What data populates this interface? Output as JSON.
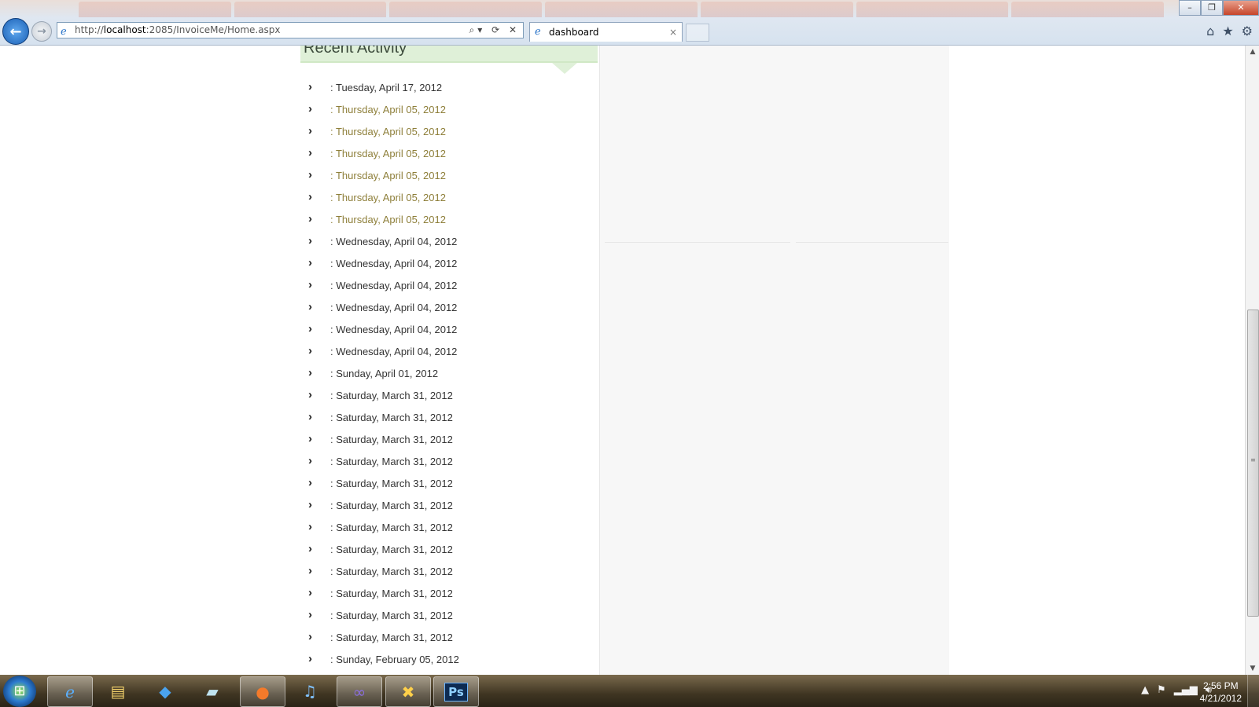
{
  "browser": {
    "address_prefix": "http://",
    "address_host": "localhost",
    "address_rest": ":2085/InvoiceMe/Home.aspx",
    "active_tab": "dashboard",
    "tab_close": "×",
    "addr_tools": "⌕▾ ⟳ ✕",
    "window_minimize": "–",
    "window_restore": "❐",
    "window_close": "✕"
  },
  "panel": {
    "title": "Recent Activity"
  },
  "activity": [
    {
      "text": ": Tuesday, April 17, 2012",
      "highlight": false
    },
    {
      "text": ": Thursday, April 05, 2012",
      "highlight": true
    },
    {
      "text": ": Thursday, April 05, 2012",
      "highlight": true
    },
    {
      "text": ": Thursday, April 05, 2012",
      "highlight": true
    },
    {
      "text": ": Thursday, April 05, 2012",
      "highlight": true
    },
    {
      "text": ": Thursday, April 05, 2012",
      "highlight": true
    },
    {
      "text": ": Thursday, April 05, 2012",
      "highlight": true
    },
    {
      "text": ": Wednesday, April 04, 2012",
      "highlight": false
    },
    {
      "text": ": Wednesday, April 04, 2012",
      "highlight": false
    },
    {
      "text": ": Wednesday, April 04, 2012",
      "highlight": false
    },
    {
      "text": ": Wednesday, April 04, 2012",
      "highlight": false
    },
    {
      "text": ": Wednesday, April 04, 2012",
      "highlight": false
    },
    {
      "text": ": Wednesday, April 04, 2012",
      "highlight": false
    },
    {
      "text": ": Sunday, April 01, 2012",
      "highlight": false
    },
    {
      "text": ": Saturday, March 31, 2012",
      "highlight": false
    },
    {
      "text": ": Saturday, March 31, 2012",
      "highlight": false
    },
    {
      "text": ": Saturday, March 31, 2012",
      "highlight": false
    },
    {
      "text": ": Saturday, March 31, 2012",
      "highlight": false
    },
    {
      "text": ": Saturday, March 31, 2012",
      "highlight": false
    },
    {
      "text": ": Saturday, March 31, 2012",
      "highlight": false
    },
    {
      "text": ": Saturday, March 31, 2012",
      "highlight": false
    },
    {
      "text": ": Saturday, March 31, 2012",
      "highlight": false
    },
    {
      "text": ": Saturday, March 31, 2012",
      "highlight": false
    },
    {
      "text": ": Saturday, March 31, 2012",
      "highlight": false
    },
    {
      "text": ": Saturday, March 31, 2012",
      "highlight": false
    },
    {
      "text": ": Saturday, March 31, 2012",
      "highlight": false
    },
    {
      "text": ": Sunday, February 05, 2012",
      "highlight": false
    }
  ],
  "taskbar": {
    "time": "2:56 PM",
    "date": "4/21/2012",
    "ps_label": "Ps"
  },
  "icons": {
    "chevron": "›"
  },
  "colors": {
    "header_bg": "#dff0d8",
    "highlight_bg": "#fdfbd7"
  }
}
